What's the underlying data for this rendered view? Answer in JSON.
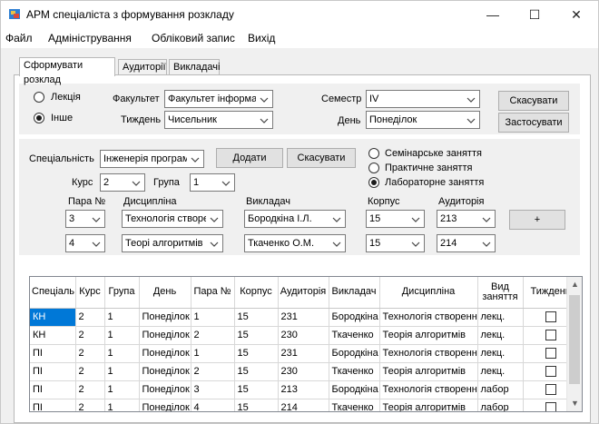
{
  "window": {
    "title": "АРМ спеціаліста з формування розкладу",
    "minimize": "—",
    "maximize": "☐",
    "close": "✕"
  },
  "menu": [
    "Файл",
    "Адміністрування",
    "Обліковий запис",
    "Вихід"
  ],
  "tabs": [
    "Сформувати розклад",
    "Аудиторії",
    "Викладачі"
  ],
  "top": {
    "lecture": "Лекція",
    "other": "Інше",
    "selected_type": "Інше",
    "faculty_label": "Факультет",
    "faculty_value": "Факультет інформа",
    "week_label": "Тиждень",
    "week_value": "Чисельник",
    "semester_label": "Семестр",
    "semester_value": "IV",
    "day_label": "День",
    "day_value": "Понеділок",
    "cancel": "Скасувати",
    "apply": "Застосувати"
  },
  "mid": {
    "specialty_label": "Спеціальність",
    "specialty_value": "Інженерія програм",
    "add": "Додати",
    "cancel": "Скасувати",
    "course_label": "Курс",
    "course_value": "2",
    "group_label": "Група",
    "group_value": "1",
    "seminar": "Семінарське заняття",
    "practical": "Практичне заняття",
    "lab": "Лабораторне заняття",
    "selected_class_type": "Лабораторне заняття",
    "pair_label": "Пара №",
    "discipline_label": "Дисципліна",
    "teacher_label": "Викладач",
    "building_label": "Корпус",
    "room_label": "Аудиторія",
    "plus": "+",
    "rows": [
      {
        "pair": "3",
        "discipline": "Технологія створен",
        "teacher": "Бородкіна І.Л.",
        "building": "15",
        "room": "213"
      },
      {
        "pair": "4",
        "discipline": "Теорі алгоритмів",
        "teacher": "Ткаченко О.М.",
        "building": "15",
        "room": "214"
      }
    ]
  },
  "grid": {
    "columns": [
      "Спеціаль",
      "Курс",
      "Група",
      "День",
      "Пара №",
      "Корпус",
      "Аудиторія",
      "Викладач",
      "Дисципліна",
      "Вид заняття",
      "Тиждень"
    ],
    "rows": [
      [
        "КН",
        "2",
        "1",
        "Понеділок",
        "1",
        "15",
        "231",
        "Бородкіна",
        "Технологія створенн...",
        "лекц.",
        ""
      ],
      [
        "КН",
        "2",
        "1",
        "Понеділок",
        "2",
        "15",
        "230",
        "Ткаченко",
        "Теорія алгоритмів",
        "лекц.",
        ""
      ],
      [
        "ПІ",
        "2",
        "1",
        "Понеділок",
        "1",
        "15",
        "231",
        "Бородкіна",
        "Технологія створенн...",
        "лекц.",
        ""
      ],
      [
        "ПІ",
        "2",
        "1",
        "Понеділок",
        "2",
        "15",
        "230",
        "Ткаченко",
        "Теорія алгоритмів",
        "лекц.",
        ""
      ],
      [
        "ПІ",
        "2",
        "1",
        "Понеділок",
        "3",
        "15",
        "213",
        "Бородкіна",
        "Технологія створенн...",
        "лабор",
        ""
      ],
      [
        "ПІ",
        "2",
        "1",
        "Понеділок",
        "4",
        "15",
        "214",
        "Ткаченко",
        "Теорія алгоритмів",
        "лабор",
        ""
      ]
    ],
    "selected_row": 0,
    "scroll_up": "▲",
    "scroll_down": "▼"
  },
  "colors": {
    "selection": "#0078d7",
    "panel_bg": "#f0f0f0",
    "button_bg": "#e1e1e1"
  },
  "icons": [
    "app-icon",
    "chevron-down-icon",
    "checkbox-icon",
    "radio-icon"
  ]
}
